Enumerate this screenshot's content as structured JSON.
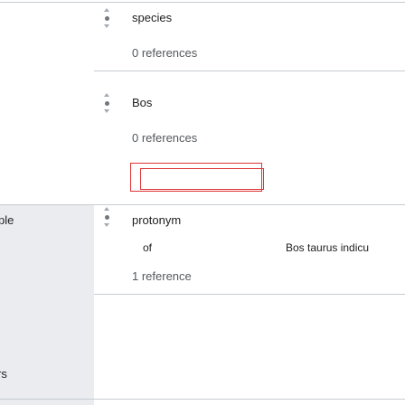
{
  "statements": [
    {
      "value": "species",
      "references": "0 references"
    },
    {
      "value": "Bos",
      "references": "0 references"
    },
    {
      "value": "protonym",
      "qualifier_property": "of",
      "qualifier_value": "Bos taurus indicu",
      "references": "1 reference"
    }
  ],
  "left_labels": {
    "label_1": "ple",
    "label_2": "rs"
  },
  "colors": {
    "highlight": "#dd3333",
    "divider": "#c8ccd1",
    "left_panel": "#eaecf0"
  },
  "icons": {
    "rank": "rank-normal-icon"
  }
}
